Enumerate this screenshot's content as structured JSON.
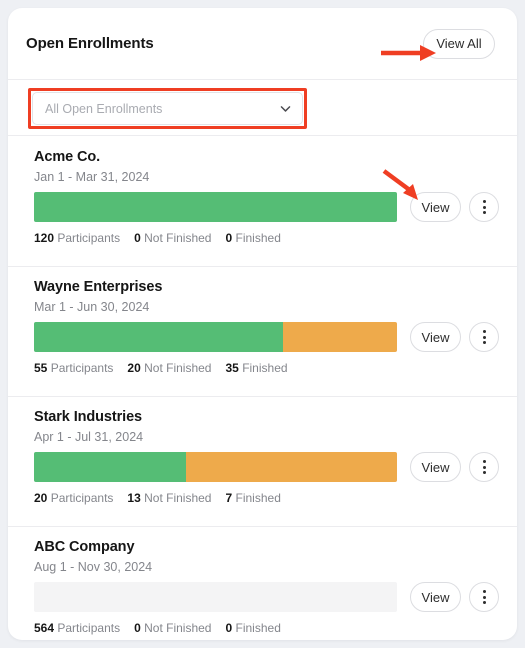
{
  "colors": {
    "page_bg": "#eef0f4",
    "card_bg": "#ffffff",
    "finished": "#55bd75",
    "not_finished": "#eeaa4b",
    "empty_bar": "#f4f4f5",
    "annotation": "#ef3e23",
    "text_primary": "#161616",
    "text_muted": "#84868c"
  },
  "header": {
    "title": "Open Enrollments",
    "view_all_label": "View All"
  },
  "filter": {
    "selected_value": "All Open Enrollments",
    "chevron_icon": "chevron-down-icon"
  },
  "row_actions": {
    "view_label": "View",
    "kebab_icon": "kebab-menu-icon"
  },
  "labels": {
    "participants": "Participants",
    "not_finished": "Not Finished",
    "finished": "Finished"
  },
  "enrollments": [
    {
      "name": "Acme Co.",
      "dates": "Jan 1 - Mar 31, 2024",
      "participants": "120",
      "not_finished": "0",
      "finished": "0",
      "finished_pct": 100,
      "not_finished_pct": 0,
      "empty": false
    },
    {
      "name": "Wayne Enterprises",
      "dates": "Mar 1 - Jun 30, 2024",
      "participants": "55",
      "not_finished": "20",
      "finished": "35",
      "finished_pct": 68.5,
      "not_finished_pct": 31.5,
      "empty": false
    },
    {
      "name": "Stark Industries",
      "dates": "Apr 1 - Jul 31, 2024",
      "participants": "20",
      "not_finished": "13",
      "finished": "7",
      "finished_pct": 42,
      "not_finished_pct": 58,
      "empty": false
    },
    {
      "name": "ABC Company",
      "dates": "Aug 1 - Nov 30, 2024",
      "participants": "564",
      "not_finished": "0",
      "finished": "0",
      "finished_pct": 0,
      "not_finished_pct": 0,
      "empty": true
    }
  ],
  "annotations": {
    "arrow_to_view_all": "red-arrow-right",
    "arrow_to_first_view": "red-arrow-diagonal",
    "box_around_filter": "red-highlight-box"
  }
}
